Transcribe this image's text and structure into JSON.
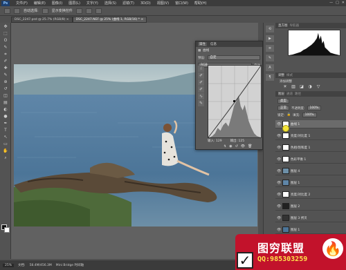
{
  "app": {
    "logo": "Ps",
    "window_buttons": [
      "—",
      "□",
      "✕"
    ]
  },
  "menu": [
    "文件(F)",
    "编辑(E)",
    "图像(I)",
    "图层(L)",
    "文字(Y)",
    "选择(S)",
    "滤镜(T)",
    "3D(D)",
    "视图(V)",
    "窗口(W)",
    "帮助(H)"
  ],
  "options_bar": {
    "auto_select": "自动选择:",
    "transform_controls": "显示变换控件"
  },
  "doc_tabs": [
    {
      "label": "DSC_2247.psd @ 25.7% (RGB/8)",
      "close": "×"
    },
    {
      "label": "DSC_2247.NEF @ 25% (曲线 1, RGB/16) *",
      "close": "×"
    }
  ],
  "tools": [
    "move-icon",
    "marquee-icon",
    "lasso-icon",
    "quick-select-icon",
    "crop-icon",
    "eyedropper-icon",
    "healing-icon",
    "brush-icon",
    "stamp-icon",
    "history-brush-icon",
    "eraser-icon",
    "gradient-icon",
    "blur-icon",
    "dodge-icon",
    "pen-icon",
    "type-icon",
    "path-select-icon",
    "shape-icon",
    "hand-icon",
    "zoom-icon"
  ],
  "tool_glyphs": [
    "✥",
    "⬚",
    "ʘ",
    "✎",
    "⌗",
    "✐",
    "✚",
    "✎",
    "⊕",
    "↺",
    "◫",
    "▤",
    "◐",
    "●",
    "✒",
    "T",
    "↖",
    "▭",
    "✋",
    "⌕"
  ],
  "curves": {
    "tab_properties": "属性",
    "tab_info": "信息",
    "name": "曲线",
    "preset_label": "预设:",
    "preset_value": "自定",
    "channel_value": "RGB",
    "auto_label": "自动",
    "input_label": "输入:",
    "input_value": "129",
    "output_label": "输出:",
    "output_value": "125",
    "foot_icons": [
      "↯",
      "◉",
      "↺",
      "👁",
      "🗑"
    ]
  },
  "histogram_panel": {
    "title": "直方图",
    "sub": "导航器"
  },
  "adjustments_panel": {
    "title": "调整",
    "sub": "样式",
    "add_label": "添加调整",
    "row1": [
      "☀",
      "▥",
      "◪",
      "◑",
      "▽"
    ],
    "row2": [
      "▦",
      "⚖",
      "◧",
      "◍",
      "▩"
    ],
    "row3": [
      "◩",
      "◫",
      "▨",
      "◆",
      "▣"
    ]
  },
  "layers_panel": {
    "title": "图层",
    "tabs_extra": [
      "通道",
      "路径"
    ],
    "kind_label": "类型",
    "blend_mode": "正常",
    "opacity_label": "不透明度:",
    "opacity_value": "100%",
    "lock_label": "锁定:",
    "fill_label": "填充:",
    "fill_value": "100%",
    "layers": [
      {
        "name": "曲线 1",
        "selected": true
      },
      {
        "name": "亮度/对比度 1",
        "selected": false
      },
      {
        "name": "色相/饱和度 1",
        "selected": false
      },
      {
        "name": "色彩平衡 1",
        "selected": false
      },
      {
        "name": "图层 4",
        "selected": false
      },
      {
        "name": "图层 1",
        "selected": false
      },
      {
        "name": "亮度/对比度 2",
        "selected": false
      },
      {
        "name": "图层 2",
        "selected": false
      },
      {
        "name": "图层 3 拷贝",
        "selected": false
      },
      {
        "name": "图层 1",
        "selected": false
      }
    ],
    "foot_icons": [
      "⛓",
      "fx",
      "◐",
      "◑",
      "▭",
      "▢",
      "🗑"
    ]
  },
  "status": {
    "zoom": "25%",
    "doc_label": "文档:",
    "doc_size": "58.4M/456.3M",
    "timeline": "Mini Bridge  时间轴"
  },
  "watermark": {
    "check": "✓",
    "title": "图穷联盟",
    "qq": "QQ:985303259",
    "logo": "flame-logo"
  },
  "colors": {
    "accent": "#c2122b",
    "panel": "#535353",
    "menubar": "#3c3c3c",
    "qq_text": "#ffe24a"
  }
}
